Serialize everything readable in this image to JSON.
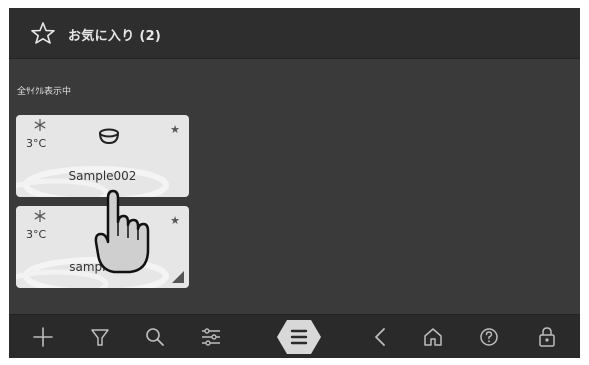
{
  "header": {
    "title": "お気に入り (2)",
    "icon": "star-outline-icon"
  },
  "cycle_label": "全ｻｲｸﾙ表示中",
  "cards": [
    {
      "temperature": "3°C",
      "name": "Sample002",
      "icon": "bowl-icon",
      "favorite_icon": "★"
    },
    {
      "temperature": "3°C",
      "name": "sample001",
      "icon": "",
      "favorite_icon": "★"
    }
  ],
  "toolbar": {
    "buttons": [
      "add-icon",
      "filter-icon",
      "search-icon",
      "settings-sliders-icon",
      "menu-icon",
      "back-icon",
      "home-icon",
      "help-icon",
      "lock-icon"
    ]
  },
  "colors": {
    "background": "#3a3a3a",
    "header": "#2e2e2e",
    "card": "#e6e6e6",
    "menu_accent": "#d8d8d8"
  }
}
